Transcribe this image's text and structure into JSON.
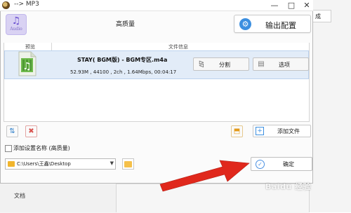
{
  "window": {
    "title": "--> MP3",
    "controls": {
      "minimize": "—",
      "maximize": "□",
      "close": "✕"
    }
  },
  "background_app": {
    "tab_label": "成",
    "sidebar_item": "文档"
  },
  "quality": {
    "icon_label": "Audio",
    "label": "高质量"
  },
  "output_button": {
    "label": "输出配置",
    "icon": "gear-icon"
  },
  "table": {
    "columns": [
      "预览",
      "文件信息"
    ],
    "rows": [
      {
        "name": "STAY( BGM版) - BGM专区.m4a",
        "meta": "52.93M , 44100 , 2ch , 1.64Mbps, 00:04:17",
        "actions": [
          {
            "label": "分割",
            "icon": "split-icon"
          },
          {
            "label": "选项",
            "icon": "options-icon"
          }
        ]
      }
    ]
  },
  "toolbar": {
    "add_file_label": "添加文件",
    "add_folder_icon": "add-folder-icon",
    "sort_icon": "sort-icon",
    "remove_icon": "remove-icon"
  },
  "options": {
    "append_setting_name_label": "添加设置名称 (高质量)",
    "append_setting_name_checked": false
  },
  "output_path": {
    "value": "C:\\Users\\王鑫\\Desktop",
    "dropdown_icon": "chevron-down-icon"
  },
  "ok_button": {
    "label": "确定"
  },
  "watermark": {
    "text": "Baidu 经验"
  },
  "colors": {
    "accent_blue": "#3c8fe0",
    "selected_row": "#e2ecf8",
    "arrow_red": "#e0281c",
    "folder_yellow": "#f1b52d"
  }
}
